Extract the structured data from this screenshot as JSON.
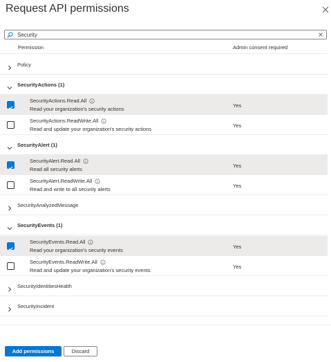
{
  "panel": {
    "title": "Request API permissions"
  },
  "search": {
    "value": "Security",
    "placeholder": ""
  },
  "table": {
    "col_permission": "Permission",
    "col_consent": "Admin consent required"
  },
  "groups": [
    {
      "label": "Policy"
    },
    {
      "label": "SecurityActions (1)"
    },
    {
      "label": "SecurityAlert (1)"
    },
    {
      "label": "SecurityAnalyzedMessage"
    },
    {
      "label": "SecurityEvents (1)"
    },
    {
      "label": "SecurityIdentitiesHealth"
    },
    {
      "label": "SecurityIncident"
    }
  ],
  "permissions": [
    {
      "name": "SecurityActions.Read.All",
      "desc": "Read your organization's security actions",
      "consent": "Yes",
      "checked": true
    },
    {
      "name": "SecurityActions.ReadWrite.All",
      "desc": "Read and update your organization's security actions",
      "consent": "Yes",
      "checked": false
    },
    {
      "name": "SecurityAlert.Read.All",
      "desc": "Read all security alerts",
      "consent": "Yes",
      "checked": true
    },
    {
      "name": "SecurityAlert.ReadWrite.All",
      "desc": "Read and write to all security alerts",
      "consent": "Yes",
      "checked": false
    },
    {
      "name": "SecurityEvents.Read.All",
      "desc": "Read your organization's security events",
      "consent": "Yes",
      "checked": true
    },
    {
      "name": "SecurityEvents.ReadWrite.All",
      "desc": "Read and update your organization's security events",
      "consent": "Yes",
      "checked": false
    }
  ],
  "footer": {
    "add_label": "Add permissions",
    "discard_label": "Discard"
  },
  "colors": {
    "accent": "#0078d4",
    "selected_row": "#edebe9"
  }
}
